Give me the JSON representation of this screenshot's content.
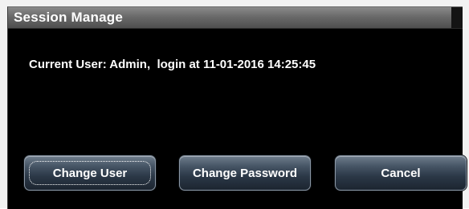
{
  "dialog": {
    "title": "Session Manage",
    "user_info": "Current User: Admin,  login at 11-01-2016 14:25:45"
  },
  "buttons": {
    "change_user": "Change User",
    "change_password": "Change Password",
    "cancel": "Cancel"
  },
  "colors": {
    "background": "#000000",
    "title_bar": "#6a6a6a",
    "button": "#2b3847",
    "text": "#ffffff"
  }
}
